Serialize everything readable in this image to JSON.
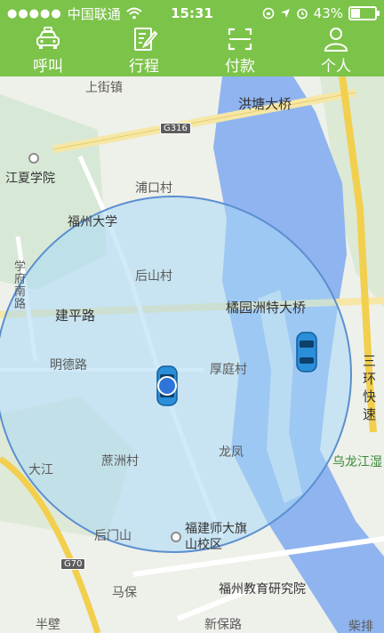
{
  "status_bar": {
    "carrier": "中国联通",
    "time": "15:31",
    "battery_percent": "43%",
    "battery_level": 0.43
  },
  "tabs": [
    {
      "label": "呼叫",
      "icon": "taxi-icon"
    },
    {
      "label": "行程",
      "icon": "edit-note-icon"
    },
    {
      "label": "付款",
      "icon": "scan-icon"
    },
    {
      "label": "个人",
      "icon": "person-icon"
    }
  ],
  "map": {
    "labels": {
      "shangjiezhen": "上街镇",
      "hongtang_bridge": "洪塘大桥",
      "jiangxia": "江夏学院",
      "pukou": "浦口村",
      "fzu": "福州大学",
      "houshan": "后山村",
      "xuefu_road": "学府南路",
      "jianping_road": "建平路",
      "juyuanzhou_bridge": "橘园洲特大桥",
      "mingde_road": "明德路",
      "houting": "厚庭村",
      "sanhuan": "三环快速",
      "dajiang": "大江",
      "zhezhou": "蔗洲村",
      "longfeng": "龙凤",
      "wulongjiang": "乌龙江湿",
      "houmenshan": "后门山",
      "fjnu": "福建师大旗山校区",
      "mabao": "马保",
      "fz_edu": "福州教育研究院",
      "banbi": "半壁",
      "xinbao_road": "新保路",
      "caipai": "柴排"
    },
    "shields": {
      "g316": "G316",
      "g70": "G70"
    }
  },
  "colors": {
    "brand_green": "#7cc34a",
    "circle_fill": "#a9d8f5",
    "river": "#8fb4f0"
  }
}
